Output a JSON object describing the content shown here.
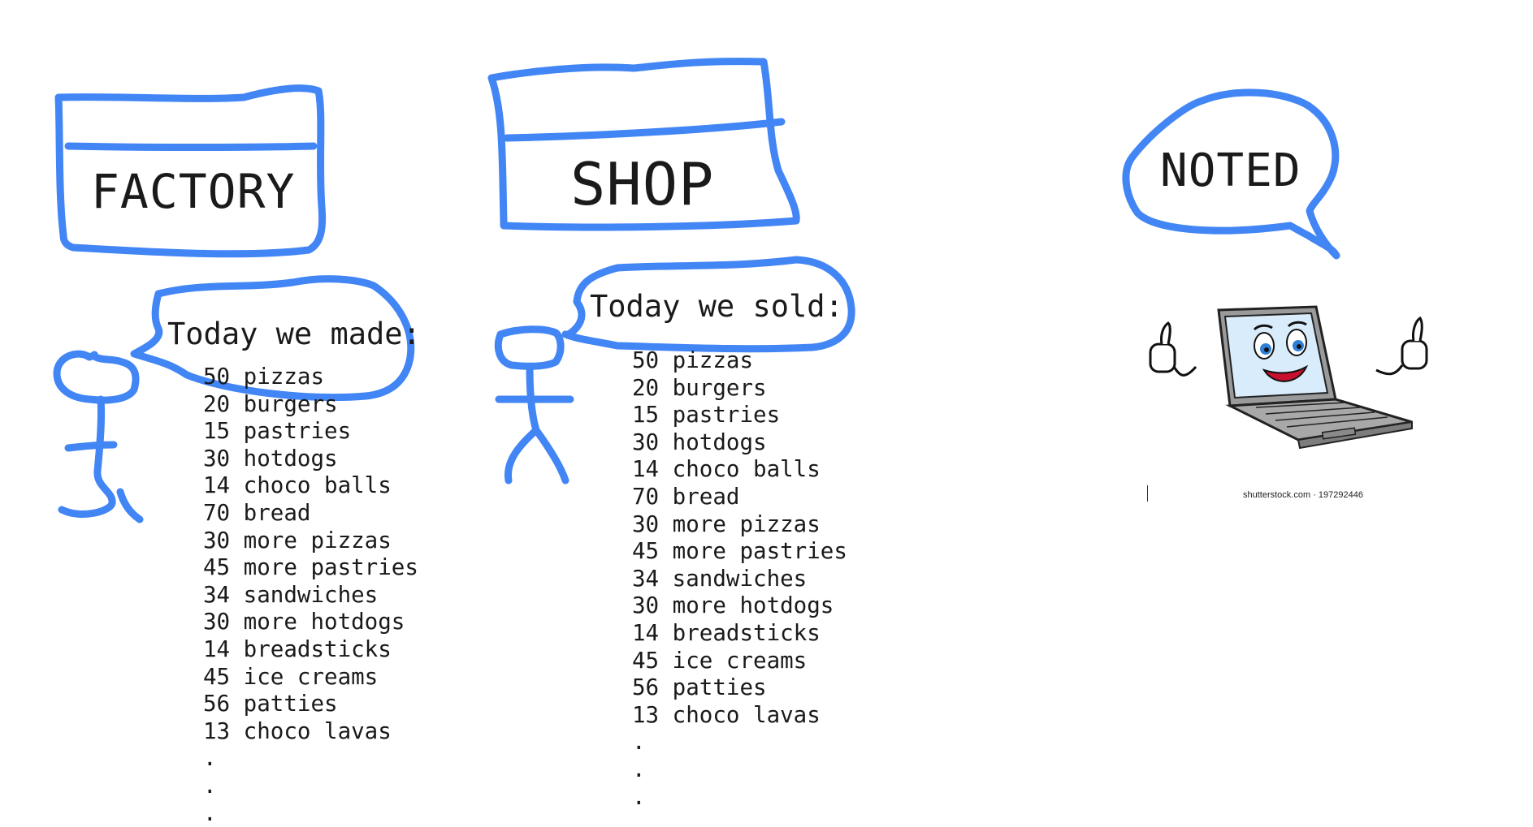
{
  "factory": {
    "title": "FACTORY",
    "bubble": "Today we made:",
    "items": [
      "50 pizzas",
      "20 burgers",
      "15 pastries",
      "30 hotdogs",
      "14 choco balls",
      "70 bread",
      "30 more pizzas",
      "45 more pastries",
      "34 sandwiches",
      "30 more hotdogs",
      "14 breadsticks",
      "45 ice creams",
      "56 patties",
      "13 choco lavas",
      ".",
      ".",
      "."
    ]
  },
  "shop": {
    "title": "SHOP",
    "bubble": "Today we sold:",
    "items": [
      "50 pizzas",
      "20 burgers",
      "15 pastries",
      "30 hotdogs",
      "14 choco balls",
      "70 bread",
      "30 more pizzas",
      "45 more pastries",
      "34 sandwiches",
      "30 more hotdogs",
      "14 breadsticks",
      "45 ice creams",
      "56 patties",
      "13 choco lavas",
      ".",
      ".",
      "."
    ]
  },
  "noted": {
    "bubble": "NOTED",
    "caption": "shutterstock.com · 197292446"
  },
  "colors": {
    "sketch_stroke": "#4285f4",
    "text": "#1a1a1a"
  },
  "icons": [
    "laptop-mascot-icon",
    "stick-figure-icon"
  ]
}
